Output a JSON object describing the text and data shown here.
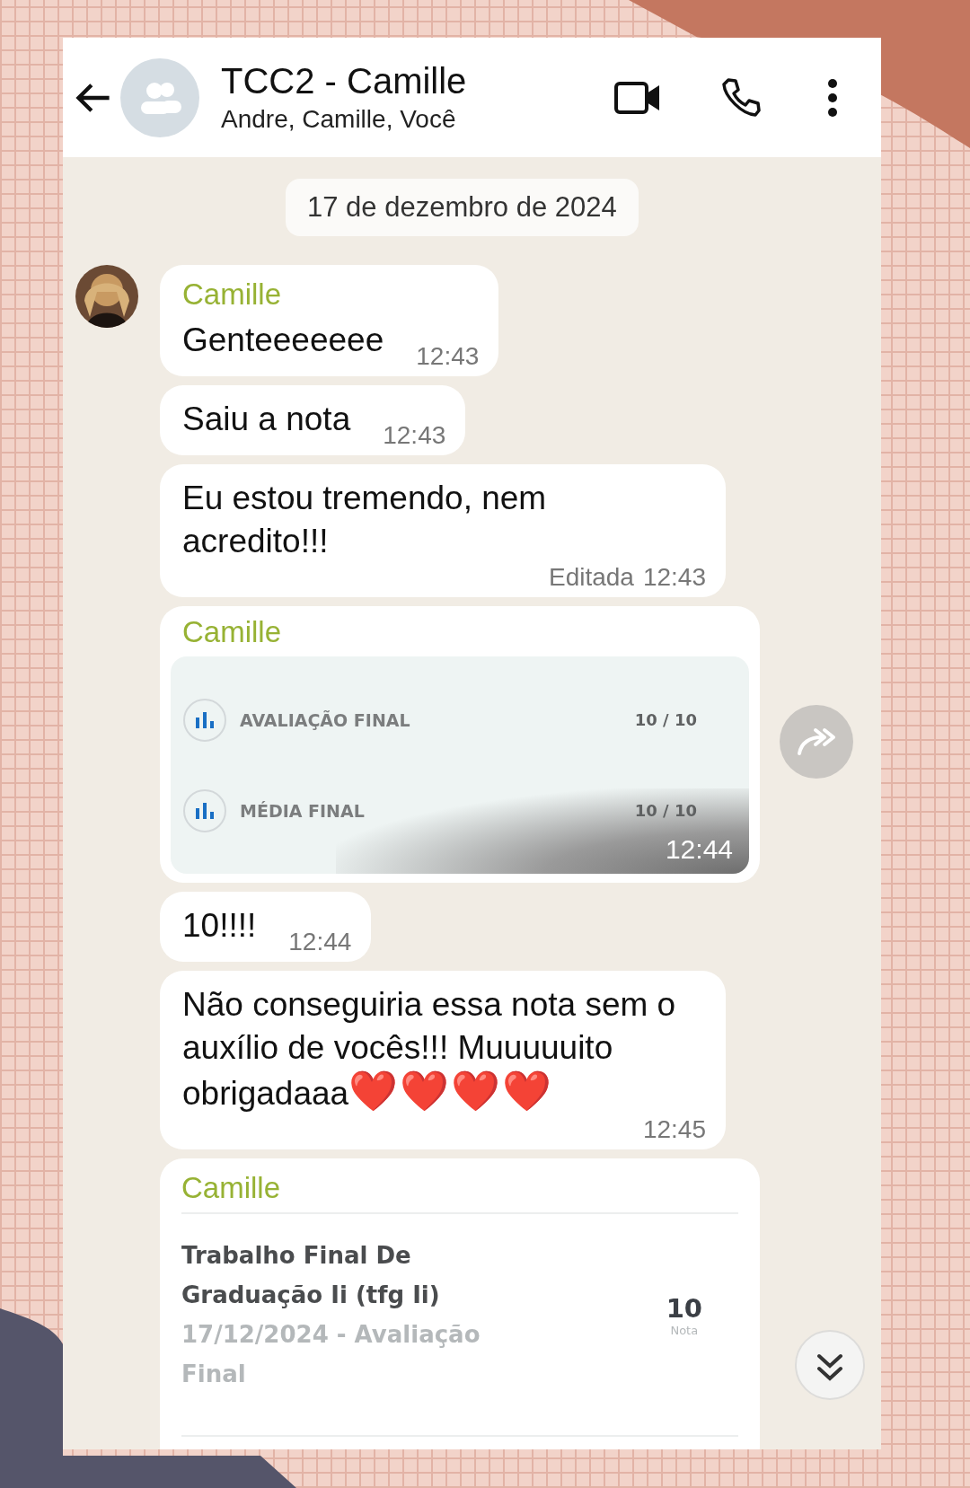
{
  "header": {
    "title": "TCC2 - Camille",
    "subtitle": "Andre, Camille, Você"
  },
  "date_chip": "17 de dezembro de 2024",
  "messages": [
    {
      "kind": "text",
      "sender": "Camille",
      "avatar": true,
      "text": "Genteeeeeee",
      "time": "12:43"
    },
    {
      "kind": "text",
      "text": "Saiu a nota",
      "time": "12:43"
    },
    {
      "kind": "text",
      "text": "Eu estou tremendo, nem acredito!!!",
      "edited_label": "Editada",
      "time": "12:43"
    },
    {
      "kind": "grades",
      "sender": "Camille",
      "forward": true,
      "time": "12:44",
      "rows": [
        {
          "label": "AVALIAÇÃO FINAL",
          "score": "10 / 10"
        },
        {
          "label": "MÉDIA FINAL",
          "score": "10 / 10"
        }
      ]
    },
    {
      "kind": "text",
      "text": "10!!!!",
      "time": "12:44"
    },
    {
      "kind": "text",
      "text": "Não conseguiria essa nota sem o auxílio de vocês!!! Muuuuuito obrigadaaa",
      "emoji": "❤️❤️❤️❤️",
      "time": "12:45"
    },
    {
      "kind": "course",
      "sender": "Camille",
      "title": "Trabalho Final De Graduação Ii (tfg Ii)",
      "subtitle": "17/12/2024 - Avaliação Final",
      "grade": "10",
      "grade_label": "Nota"
    }
  ]
}
